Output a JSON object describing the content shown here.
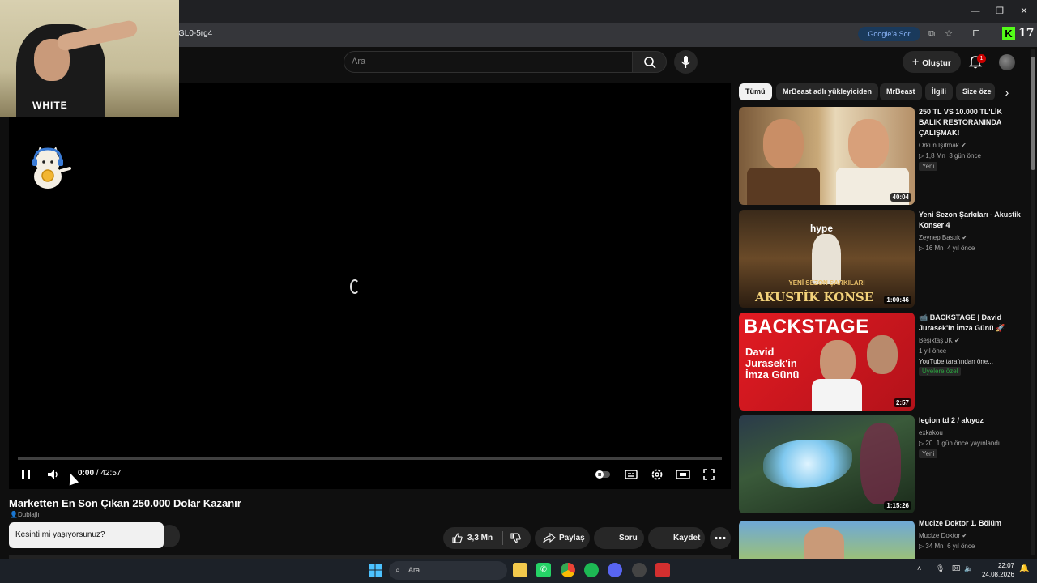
{
  "browser": {
    "url_fragment": "GL0-5rg4",
    "google_sor": "Google'a Sor",
    "kick_logo": "K",
    "kick_count": "17"
  },
  "header": {
    "search_placeholder": "Ara",
    "create_label": "Oluştur",
    "notification_count": "1"
  },
  "webcam": {
    "shirt_text": "WHITE"
  },
  "player": {
    "time_current": "0:00",
    "time_sep": " / ",
    "time_total": "42:57"
  },
  "video": {
    "title": "Marketten En Son Çıkan 250.000 Dolar Kazanır",
    "dub_badge": "Dublajlı",
    "popup_text": "Kesinti mi yaşıyorsunuz?",
    "like_count": "3,3 Mn",
    "share_label": "Paylaş",
    "soru_label": "Soru",
    "kaydet_label": "Kaydet"
  },
  "chips": [
    "Tümü",
    "MrBeast adlı yükleyiciden",
    "MrBeast",
    "İlgili",
    "Size öze"
  ],
  "recommendations": [
    {
      "title": "250 TL VS 10.000 TL'LİK BALIK RESTORANINDA ÇALIŞMAK!",
      "channel": "Orkun Işıtmak",
      "views": "1,8 Mn",
      "age": "3 gün önce",
      "badge": "Yeni",
      "duration": "40:04"
    },
    {
      "title": "Yeni Sezon Şarkıları - Akustik Konser 4",
      "channel": "Zeynep Bastık",
      "views": "16 Mn",
      "age": "4 yıl önce",
      "badge": "",
      "duration": "1:00:46",
      "thumb_text1": "hype",
      "thumb_text2": "YENİ SEZON ŞARKILARI",
      "thumb_text3": "AKUSTİK KONSE"
    },
    {
      "title": "📹 BACKSTAGE | David Jurasek'in İmza Günü 🚀",
      "channel": "Beşiktaş JK",
      "views": "",
      "age": "1 yıl önce",
      "note": "YouTube tarafından öne...",
      "members": "Üyelere özel",
      "duration": "2:57",
      "thumb_text1": "BACKSTAGE",
      "thumb_text2": "David Jurasek'in İmza Günü"
    },
    {
      "title": "legion td 2 / akıyoz",
      "channel": "exkakou",
      "views": "20",
      "age": "1 gün önce yayınlandı",
      "badge": "Yeni",
      "duration": "1:15:26"
    },
    {
      "title": "Mucize Doktor 1. Bölüm",
      "channel": "Mucize Doktor",
      "views": "34 Mn",
      "age": "6 yıl önce",
      "badge": "",
      "duration": ""
    }
  ],
  "taskbar": {
    "search_label": "Ara",
    "time": "22:07",
    "date": "24.08.2026"
  }
}
